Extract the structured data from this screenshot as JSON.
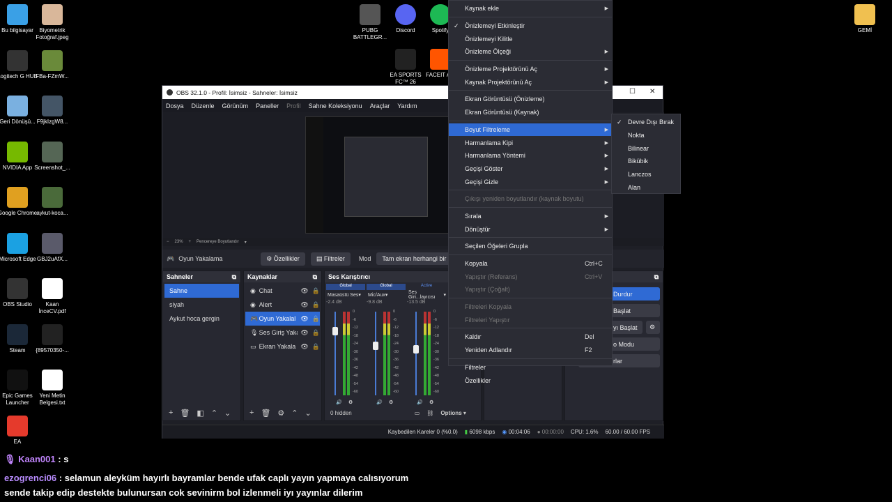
{
  "desktop_icons": [
    {
      "label": "Bu bilgisayar",
      "icon": "computer-icon",
      "color": "#3aa0e6"
    },
    {
      "label": "Biyometrik Fotoğraf.jpeg",
      "icon": "photo-icon",
      "color": "#d9b79a"
    },
    {
      "label": "Logitech G HUB",
      "icon": "logitech-icon",
      "color": "#333333"
    },
    {
      "label": "FBa-FZmW...",
      "icon": "image-icon",
      "color": "#6a8a3a"
    },
    {
      "label": "Geri Dönüşü...",
      "icon": "recycle-bin-icon",
      "color": "#7ab0e0"
    },
    {
      "label": "F9jkIzgW8...",
      "icon": "image-icon",
      "color": "#445566"
    },
    {
      "label": "NVIDIA App",
      "icon": "nvidia-icon",
      "color": "#76b900"
    },
    {
      "label": "Screenshot_...",
      "icon": "image-icon",
      "color": "#556655"
    },
    {
      "label": "Google Chrome",
      "icon": "chrome-icon",
      "color": "#e0a020"
    },
    {
      "label": "aykut-koca...",
      "icon": "image-icon",
      "color": "#4a6a3a"
    },
    {
      "label": "Microsoft Edge",
      "icon": "edge-icon",
      "color": "#1ba1e2"
    },
    {
      "label": "GBJ2uAfX...",
      "icon": "image-icon",
      "color": "#5a5a6a"
    },
    {
      "label": "OBS Studio",
      "icon": "obs-icon",
      "color": "#333333"
    },
    {
      "label": "Kaan İnceCV.pdf",
      "icon": "pdf-icon",
      "color": "#ffffff"
    },
    {
      "label": "Steam",
      "icon": "steam-icon",
      "color": "#1b2838"
    },
    {
      "label": "{89570350-...",
      "icon": "image-icon",
      "color": "#222222"
    },
    {
      "label": "Epic Games Launcher",
      "icon": "epic-icon",
      "color": "#111111"
    },
    {
      "label": "Yeni Metin Belgesi.txt",
      "icon": "text-file-icon",
      "color": "#ffffff"
    },
    {
      "label": "EA",
      "icon": "ea-icon",
      "color": "#e53a2c"
    }
  ],
  "top_icons": [
    {
      "label": "PUBG BATTLEGR...",
      "icon": "pubg-icon",
      "color": "#555555"
    },
    {
      "label": "Discord",
      "icon": "discord-icon",
      "color": "#5865f2"
    },
    {
      "label": "Spotify",
      "icon": "spotify-icon",
      "color": "#1db954"
    },
    {
      "label": "EA SPORTS FC™ 26",
      "icon": "fc-icon",
      "color": "#222222"
    },
    {
      "label": "FACEIT A...",
      "icon": "faceit-icon",
      "color": "#ff5500"
    },
    {
      "label": "GEMİ",
      "icon": "folder-icon",
      "color": "#f0c050"
    }
  ],
  "obs": {
    "title": "OBS 32.1.0 - Profil: İsimsiz - Sahneler: İsimsiz",
    "menu": [
      "Dosya",
      "Düzenle",
      "Görünüm",
      "Paneller",
      "Profil",
      "Sahne Koleksiyonu",
      "Araçlar",
      "Yardım"
    ],
    "zoom": "23%",
    "zoom_mode": "Pencereye Boyutlandır",
    "source_name": "Oyun Yakalama",
    "props_btn": "Özellikler",
    "filters_btn": "Filtreler",
    "mode_label": "Mod",
    "mode_value": "Tam ekran herhangi bir u",
    "scenes_title": "Sahneler",
    "scenes": [
      "Sahne",
      "siyah",
      "Aykut hoca gergin"
    ],
    "sources_title": "Kaynaklar",
    "sources": [
      "Chat",
      "Alert",
      "Oyun Yakalal",
      "Ses Giriş Yaka",
      "Ekran Yakala"
    ],
    "mixer_title": "Ses Karıştırıcı",
    "mixer": [
      {
        "tag": "Global",
        "name": "Masaüstü Ses",
        "db": "-2.4 dB",
        "level": 0.82
      },
      {
        "tag": "Global",
        "name": "Mic/Aux",
        "db": "-9.8 dB",
        "level": 0.64
      },
      {
        "tag": "Active",
        "name": "Ses Giri...layıcısı",
        "db": "-13.5 dB",
        "level": 0.6
      }
    ],
    "meter_ticks": [
      "0",
      "-6",
      "-12",
      "-18",
      "-24",
      "-30",
      "-36",
      "-42",
      "-48",
      "-54",
      "-60"
    ],
    "hidden": "0 hidden",
    "options": "Options",
    "controls": [
      "Durdur",
      "Başlat",
      "yı Başlat",
      "o Modu",
      "rlar"
    ],
    "status": {
      "dropped": "Kaybedilen Kareler 0 (%0.0)",
      "bitrate": "6098 kbps",
      "rec_time": "00:04:06",
      "stream_time": "00:00:00",
      "cpu": "CPU: 1.6%",
      "fps": "60.00 / 60.00 FPS"
    }
  },
  "context_menu": [
    {
      "label": "Kaynak ekle",
      "sub": true
    },
    {
      "sep": true
    },
    {
      "label": "Önizlemeyi Etkinleştir",
      "check": true
    },
    {
      "label": "Önizlemeyi Kilitle"
    },
    {
      "label": "Önizleme Ölçeği",
      "sub": true
    },
    {
      "sep": true
    },
    {
      "label": "Önizleme Projektörünü Aç",
      "sub": true
    },
    {
      "label": "Kaynak Projektörünü Aç",
      "sub": true
    },
    {
      "sep": true
    },
    {
      "label": "Ekran Görüntüsü (Önizleme)"
    },
    {
      "label": "Ekran Görüntüsü (Kaynak)"
    },
    {
      "sep": true
    },
    {
      "label": "Boyut Filtreleme",
      "sub": true,
      "hl": true
    },
    {
      "label": "Harmanlama Kipi",
      "sub": true
    },
    {
      "label": "Harmanlama Yöntemi",
      "sub": true
    },
    {
      "label": "Geçişi Göster",
      "sub": true
    },
    {
      "label": "Geçişi Gizle",
      "sub": true
    },
    {
      "sep": true
    },
    {
      "label": "Çıkışı yeniden boyutlandır (kaynak boyutu)",
      "dis": true
    },
    {
      "sep": true
    },
    {
      "label": "Sırala",
      "sub": true
    },
    {
      "label": "Dönüştür",
      "sub": true
    },
    {
      "sep": true
    },
    {
      "label": "Seçilen Öğeleri Grupla"
    },
    {
      "sep": true
    },
    {
      "label": "Kopyala",
      "sc": "Ctrl+C"
    },
    {
      "label": "Yapıştır (Referans)",
      "sc": "Ctrl+V",
      "dis": true
    },
    {
      "label": "Yapıştır (Çoğalt)",
      "dis": true
    },
    {
      "sep": true
    },
    {
      "label": "Filtreleri Kopyala",
      "dis": true
    },
    {
      "label": "Filtreleri Yapıştır",
      "dis": true
    },
    {
      "sep": true
    },
    {
      "label": "Kaldır",
      "sc": "Del"
    },
    {
      "label": "Yeniden Adlandır",
      "sc": "F2"
    },
    {
      "sep": true
    },
    {
      "label": "Filtreler"
    },
    {
      "label": "Özellikler"
    }
  ],
  "submenu": [
    {
      "label": "Devre Dışı Bırak",
      "check": true
    },
    {
      "label": "Nokta"
    },
    {
      "label": "Bilinear"
    },
    {
      "label": "Bikübik"
    },
    {
      "label": "Lanczos"
    },
    {
      "label": "Alan"
    }
  ],
  "chat": {
    "line1_user": "Kaan001",
    "line1_msg": ": s",
    "line2_user": "ezogrenci06",
    "line2_msg": ": selamun aleyküm hayırlı bayramlar bende ufak caplı yayın yapmaya calısıyorum",
    "line3_msg": "sende takip edip destekte bulunursan cok sevinirm bol izlenmeli iyı yayınlar dilerim",
    "user1_color": "#c084fc",
    "user2_color": "#b98cff"
  }
}
